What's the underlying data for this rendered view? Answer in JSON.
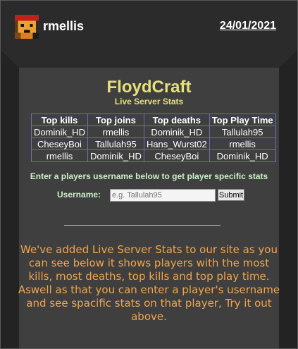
{
  "header": {
    "username": "rmellis",
    "date": "24/01/2021"
  },
  "main": {
    "title": "FloydCraft",
    "subtitle": "Live Server Stats",
    "table": {
      "headers": [
        "Top kills",
        "Top joins",
        "Top deaths",
        "Top Play Time"
      ],
      "rows": [
        [
          "Dominik_HD",
          "rmellis",
          "Dominik_HD",
          "Tallulah95"
        ],
        [
          "CheseyBoi",
          "Tallulah95",
          "Hans_Wurst02",
          "rmellis"
        ],
        [
          "rmellis",
          "Dominik_HD",
          "CheseyBoi",
          "Dominik_HD"
        ]
      ]
    },
    "prompt": "Enter a players username below to get player specific stats",
    "form": {
      "label": "Username:",
      "placeholder": "e.g. Tallulah95",
      "submit": "Submit"
    },
    "description": "We've added Live Server Stats to our site as you can see below it shows players with the most kills, most deaths, top kills and top play time. Aswell as that you can enter a player's username and see spacific stats on that player, Try it out above."
  },
  "colors": {
    "title": "#e6e07a",
    "prompt": "#c9f2c4",
    "description": "#f2a54b",
    "table_border": "#6b6fb0",
    "divider": "#7fd8b8"
  },
  "icons": {
    "avatar": "minecraft-avatar-icon"
  }
}
